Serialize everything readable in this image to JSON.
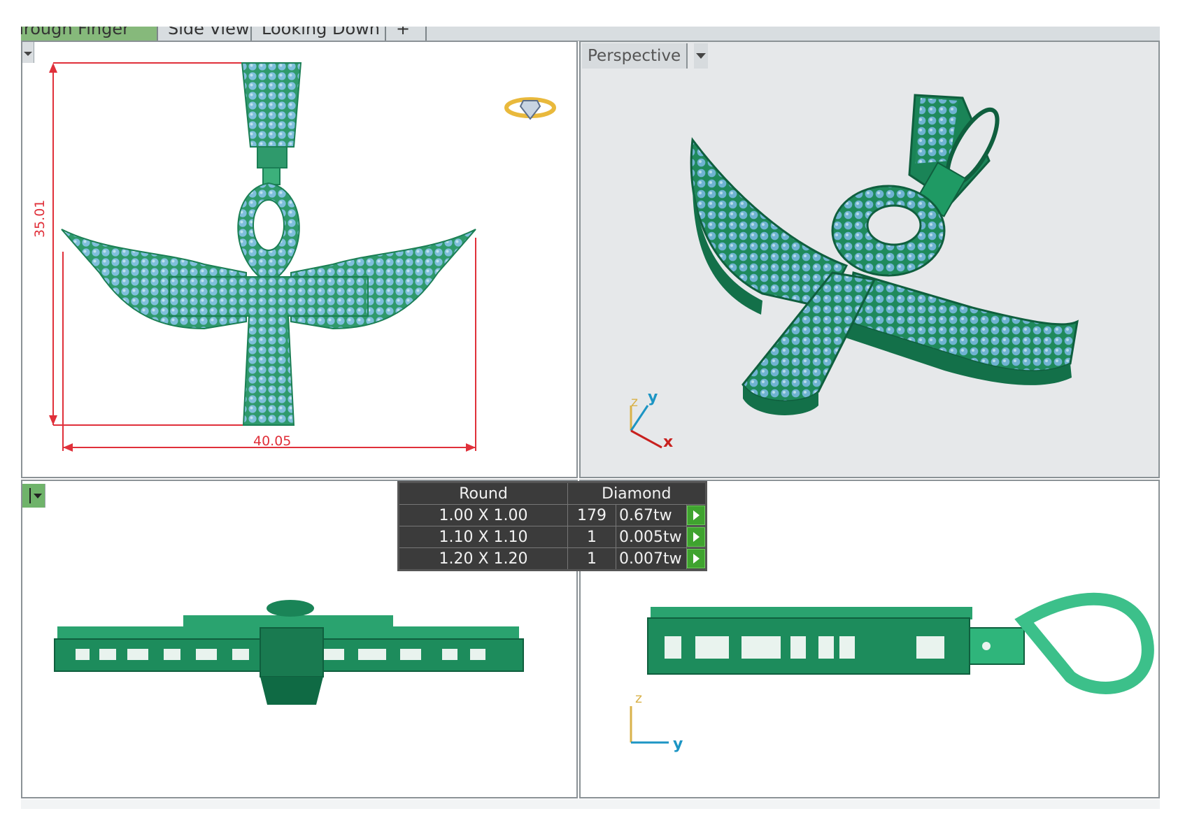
{
  "tabs": [
    {
      "label": "Through Finger",
      "active": true
    },
    {
      "label": "Side View",
      "active": false
    },
    {
      "label": "Looking Down",
      "active": false
    },
    {
      "label": "+",
      "active": false
    }
  ],
  "viewports": {
    "front": {
      "height_dim": "35.01",
      "width_dim": "40.05",
      "icon": "ring-diamond-icon"
    },
    "perspective": {
      "label": "Perspective",
      "axes": [
        "z",
        "y",
        "x"
      ]
    },
    "side_left": {},
    "side_right": {
      "axes": [
        "z",
        "y"
      ]
    }
  },
  "gem_table": {
    "headers": [
      "Round",
      "Diamond"
    ],
    "rows": [
      {
        "size": "1.00 X 1.00",
        "count": "179",
        "weight": "0.67tw"
      },
      {
        "size": "1.10 X 1.10",
        "count": "1",
        "weight": "0.005tw"
      },
      {
        "size": "1.20 X 1.20",
        "count": "1",
        "weight": "0.007tw"
      }
    ]
  },
  "colors": {
    "metal": "#1e8a5e",
    "metal_light": "#3cc08a",
    "stone": "#78b9d6",
    "dimension": "#e0303a",
    "axis_x": "#c8201e",
    "axis_y": "#1d95c4",
    "axis_z": "#d9b24a"
  }
}
